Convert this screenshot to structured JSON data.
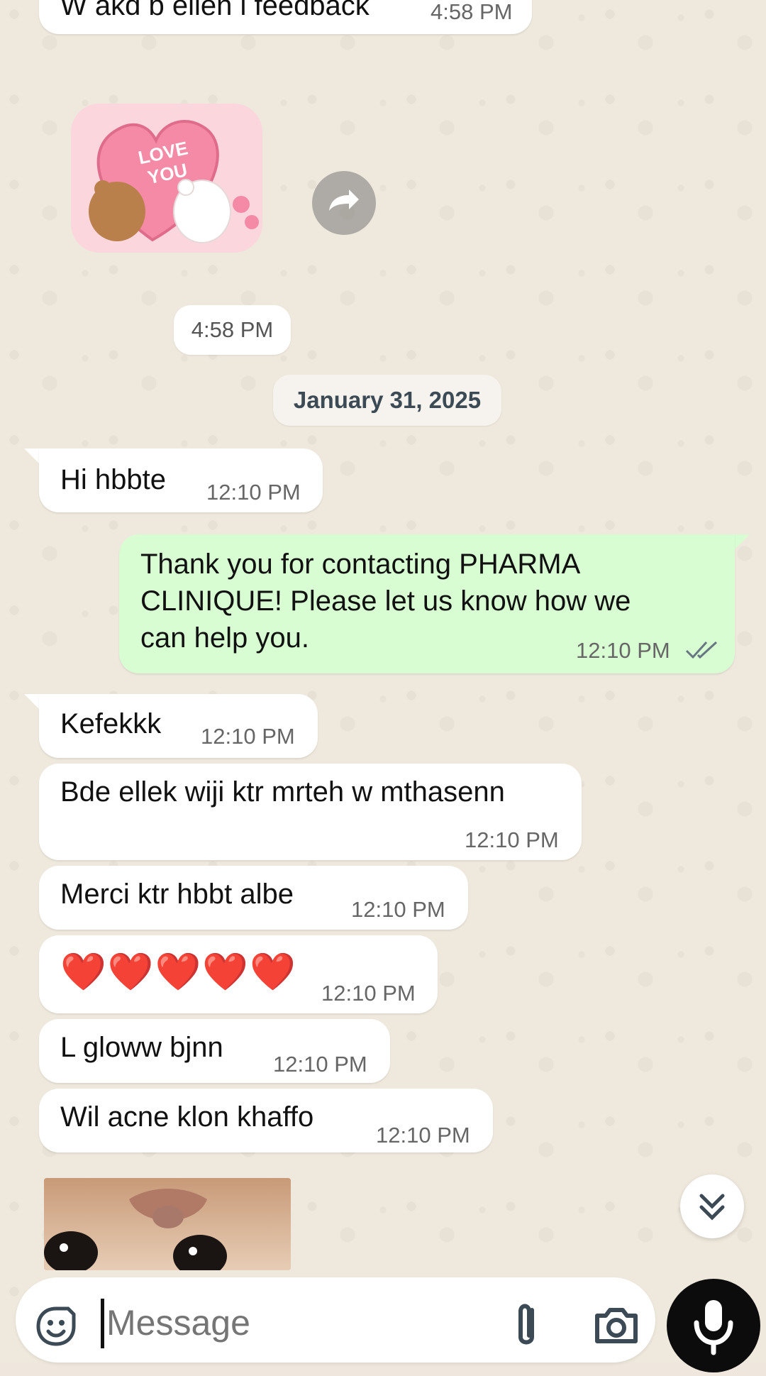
{
  "messages": [
    {
      "id": "m0",
      "text": "W akd b ellen l feedback",
      "time": "4:58 PM",
      "dir": "in"
    },
    {
      "id": "m1",
      "sticker_text": "LOVE YOU",
      "time": "4:58 PM"
    },
    {
      "date_separator": "January 31, 2025"
    },
    {
      "id": "m2",
      "text": "Hi hbbte",
      "time": "12:10 PM",
      "dir": "in"
    },
    {
      "id": "m3",
      "text_lines": [
        "Thank you for contacting PHARMA",
        "CLINIQUE! Please let us know how we",
        "can help you."
      ],
      "time": "12:10 PM",
      "dir": "out",
      "status": "read"
    },
    {
      "id": "m4",
      "text": "Kefekkk",
      "time": "12:10 PM",
      "dir": "in"
    },
    {
      "id": "m5",
      "text": "Bde ellek wiji ktr mrteh w mthasenn",
      "time": "12:10 PM",
      "dir": "in"
    },
    {
      "id": "m6",
      "text": "Merci ktr hbbt albe",
      "time": "12:10 PM",
      "dir": "in"
    },
    {
      "id": "m7",
      "text": "❤️❤️❤️❤️❤️",
      "time": "12:10 PM",
      "dir": "in"
    },
    {
      "id": "m8",
      "text": "L gloww bjnn",
      "time": "12:10 PM",
      "dir": "in"
    },
    {
      "id": "m9",
      "text": "Wil acne klon khaffo",
      "time": "12:10 PM",
      "dir": "in"
    }
  ],
  "composer": {
    "placeholder": "Message"
  },
  "icons": {
    "sticker": "sticker-icon",
    "attach": "paperclip-icon",
    "camera": "camera-icon",
    "mic": "microphone-icon",
    "forward": "forward-icon",
    "scroll_down": "double-chevron-down-icon",
    "read_status": "double-check-icon"
  },
  "colors": {
    "outgoing_bubble": "#d9fdd3",
    "incoming_bubble": "#ffffff",
    "chat_background": "#efe9dd",
    "mic_button": "#0c0c0c"
  }
}
